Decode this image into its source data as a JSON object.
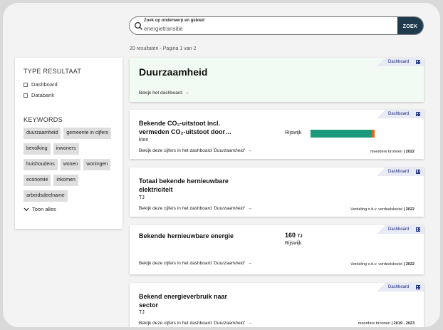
{
  "search": {
    "label": "Zoek op onderwerp en gebied",
    "value": "energietransitie",
    "button": "ZOEK"
  },
  "results_count": "20 resultaten - Pagina 1 van 2",
  "sidebar": {
    "type_title": "TYPE RESULTAAT",
    "types": [
      "Dashboard",
      "Databank"
    ],
    "keywords_title": "KEYWORDS",
    "keywords": [
      "duurzaamheid",
      "gemeente in cijfers",
      "bevolking",
      "inwoners",
      "huishoudens",
      "wonen",
      "woningen",
      "economie",
      "inkomen",
      "arbeidsdeelname"
    ],
    "show_all": "Toon alles"
  },
  "cards": [
    {
      "badge": "Dashboard",
      "title": "Duurzaamheid",
      "link": "Bekijk het dashboard"
    },
    {
      "badge": "Dashboard",
      "title_line1": "Bekende CO₂-uitstoot incl.",
      "title_line2": "vermeden CO₂-uitstoot door…",
      "unit": "kton",
      "region": "Rijswijk",
      "bar": {
        "green_fraction": 0.95,
        "green_color": "#1a9a7a",
        "orange_color": "#e06a1a"
      },
      "link_prefix": "Bekijk deze cijfers in het dashboard",
      "link_dashboard": "'Duurzaamheid'",
      "meta_source": "meerdere bronnen",
      "meta_sep": "|",
      "meta_year": "2022"
    },
    {
      "badge": "Dashboard",
      "title_line1": "Totaal bekende hernieuwbare",
      "title_line2": "elektriciteit",
      "unit": "TJ",
      "link_prefix": "Bekijk deze cijfers in het dashboard",
      "link_dashboard": "'Duurzaamheid'",
      "meta_source": "Verdeling o.b.v. verdeelsleutel",
      "meta_sep": "|",
      "meta_year": "2022"
    },
    {
      "badge": "Dashboard",
      "title_line1": "Bekende hernieuwbare energie",
      "value": "160",
      "value_unit": "TJ",
      "region": "Rijswijk",
      "link_prefix": "Bekijk deze cijfers in het dashboard",
      "link_dashboard": "'Duurzaamheid'",
      "meta_source": "Verdeling o.b.v. verdeelsleutel",
      "meta_sep": "|",
      "meta_year": "2022"
    },
    {
      "badge": "Dashboard",
      "title_line1": "Bekend energieverbruik naar",
      "title_line2": "sector",
      "unit": "TJ",
      "link_prefix": "Bekijk deze cijfers in het dashboard",
      "link_dashboard": "'Duurzaamheid'",
      "meta_source": "meerdere bronnen",
      "meta_sep": "|",
      "meta_year": "2019 - 2023"
    }
  ],
  "colors": {
    "accent_dark": "#1f3a4d",
    "badge_bg": "#e8eaf6",
    "badge_text": "#1b2a7a",
    "highlight_bg": "#f1fbf3"
  }
}
